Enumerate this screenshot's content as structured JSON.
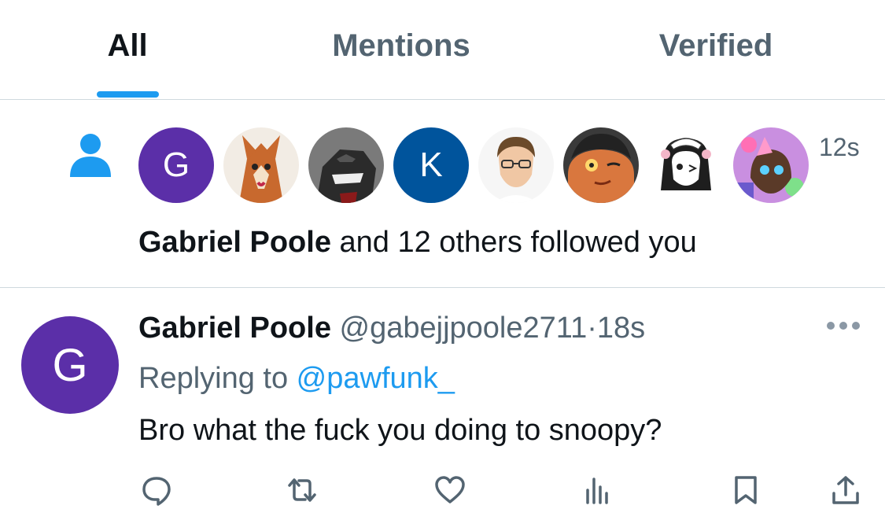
{
  "tabs": [
    {
      "label": "All",
      "active": true
    },
    {
      "label": "Mentions",
      "active": false
    },
    {
      "label": "Verified",
      "active": false
    }
  ],
  "colors": {
    "accent": "#1d9bf0",
    "text": "#0f1419",
    "muted": "#536471",
    "divider": "#cfd9de"
  },
  "follow_notification": {
    "icon": "person-icon",
    "time": "12s",
    "name": "Gabriel Poole",
    "text_rest": " and 12 others followed you",
    "avatars": [
      {
        "kind": "letter",
        "letter": "G",
        "color": "#5b2fa8"
      },
      {
        "kind": "image",
        "description": "fox character"
      },
      {
        "kind": "image",
        "description": "godzilla"
      },
      {
        "kind": "letter",
        "letter": "K",
        "color": "#00549c"
      },
      {
        "kind": "image",
        "description": "man with glasses"
      },
      {
        "kind": "image",
        "description": "cartoon character"
      },
      {
        "kind": "image",
        "description": "anime maid"
      },
      {
        "kind": "image",
        "description": "colorful character"
      }
    ]
  },
  "tweet": {
    "avatar_letter": "G",
    "name": "Gabriel Poole",
    "handle": "@gabejjpoole2711",
    "separator": "·",
    "time": "18s",
    "replying_prefix": "Replying to ",
    "replying_handle": "@pawfunk_",
    "text": "Bro what the fuck you doing to snoopy?",
    "actions": [
      "reply-icon",
      "retweet-icon",
      "like-icon",
      "views-icon",
      "bookmark-icon",
      "share-icon"
    ]
  }
}
